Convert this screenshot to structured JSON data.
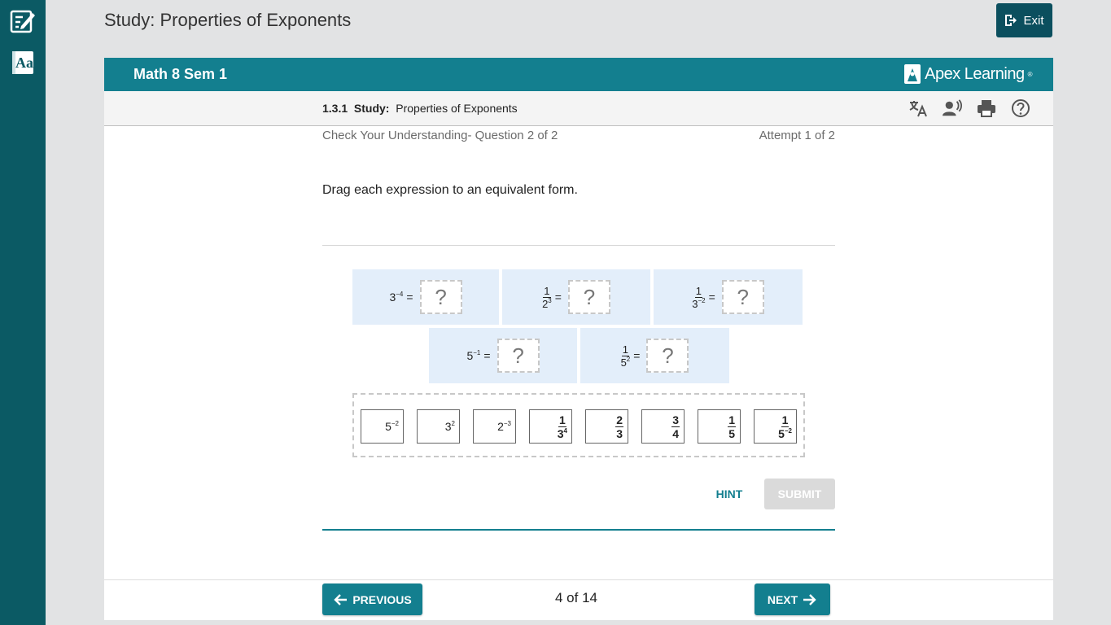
{
  "sidebar": {
    "items": [
      {
        "icon": "notes-edit-icon"
      },
      {
        "icon": "glossary-icon",
        "label": "Aa"
      }
    ]
  },
  "topbar": {
    "title": "Study: Properties of Exponents",
    "exit_label": "Exit"
  },
  "course": {
    "title": "Math 8 Sem 1",
    "brand": "Apex Learning",
    "brand_mark": "®"
  },
  "breadcrumb": {
    "number": "1.3.1",
    "kind": "Study:",
    "title": "Properties of Exponents"
  },
  "tools": [
    {
      "icon": "translate-icon"
    },
    {
      "icon": "read-aloud-icon"
    },
    {
      "icon": "print-icon"
    },
    {
      "icon": "help-icon"
    }
  ],
  "question": {
    "check_label": "Check Your Understanding- Question 2 of 2",
    "attempt_label": "Attempt 1 of 2",
    "instruction": "Drag each expression to an equivalent form.",
    "placeholder": "?",
    "equals": "="
  },
  "targets": {
    "t1": {
      "base": "3",
      "exp": "−4"
    },
    "t2": {
      "num": "1",
      "base": "2",
      "exp": "3"
    },
    "t3": {
      "num": "1",
      "base": "3",
      "exp": "−2"
    },
    "t4": {
      "base": "5",
      "exp": "−1"
    },
    "t5": {
      "num": "1",
      "base": "5",
      "exp": "2"
    }
  },
  "tiles": {
    "a": {
      "base": "5",
      "exp": "−2"
    },
    "b": {
      "base": "3",
      "exp": "2"
    },
    "c": {
      "base": "2",
      "exp": "−3"
    },
    "d": {
      "num": "1",
      "base": "3",
      "exp": "4"
    },
    "e": {
      "num": "2",
      "den": "3"
    },
    "f": {
      "num": "3",
      "den": "4"
    },
    "g": {
      "num": "1",
      "den": "5"
    },
    "h": {
      "num": "1",
      "base": "5",
      "exp": "−2"
    }
  },
  "actions": {
    "hint_label": "HINT",
    "submit_label": "SUBMIT"
  },
  "footer": {
    "prev_label": "PREVIOUS",
    "next_label": "NEXT",
    "page_count": "4 of 14"
  },
  "colors": {
    "teal": "#137f8f",
    "dark_teal": "#0b5a64",
    "target_bg": "#e3eefa",
    "submit_disabled": "#dadada"
  }
}
